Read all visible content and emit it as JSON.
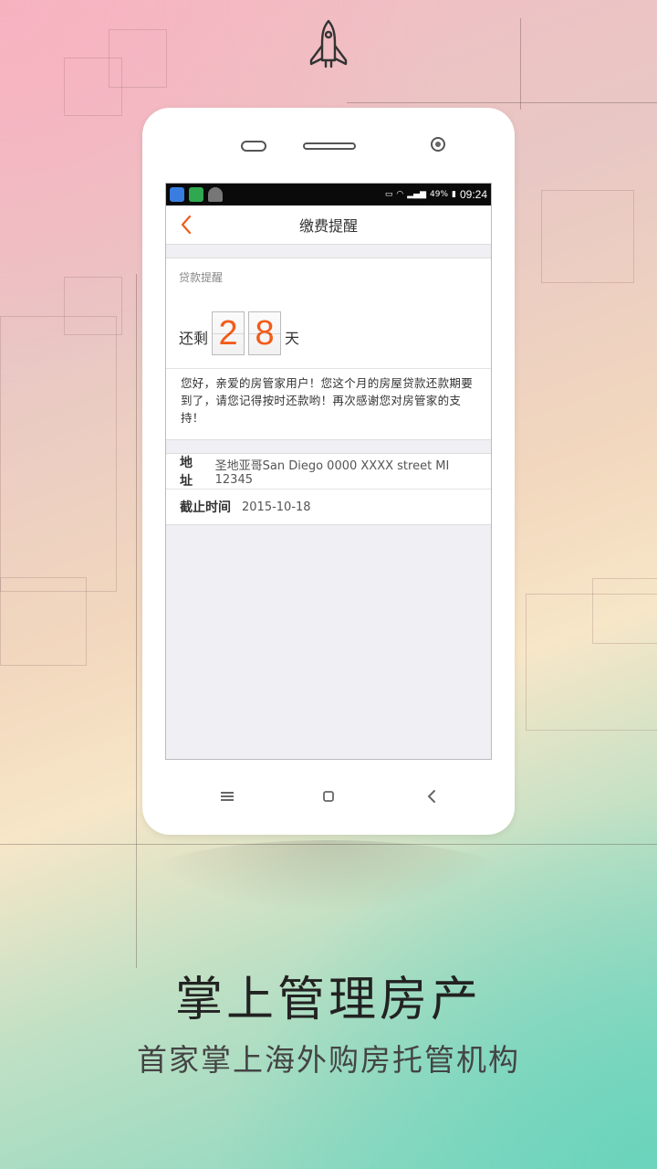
{
  "screen": {
    "status_bar": {
      "time": "09:24",
      "battery": "49%",
      "icons": [
        "weather-app-icon",
        "security-app-icon",
        "android-debug-icon",
        "nfc-icon",
        "wifi-icon",
        "signal-icon",
        "battery-icon"
      ]
    },
    "navbar": {
      "title": "缴费提醒",
      "back_icon": "chevron-left-icon"
    },
    "reminder": {
      "label": "贷款提醒",
      "prefix": "还剩",
      "digit_1": "2",
      "digit_2": "8",
      "suffix": "天",
      "message": "您好，亲爱的房管家用户！您这个月的房屋贷款还款期要到了，请您记得按时还款哟！再次感谢您对房管家的支持！"
    },
    "details": {
      "address_key": "地址",
      "address_value": "圣地亚哥San Diego 0000 XXXX street MI 12345",
      "deadline_key": "截止时间",
      "deadline_value": "2015-10-18"
    },
    "softkeys": [
      "menu-icon",
      "home-icon",
      "back-icon"
    ]
  },
  "promo": {
    "headline": "掌上管理房产",
    "subline": "首家掌上海外购房托管机构",
    "top_icon": "rocket-icon"
  },
  "colors": {
    "accent": "#f25c19",
    "screen_bg": "#efeff4"
  }
}
